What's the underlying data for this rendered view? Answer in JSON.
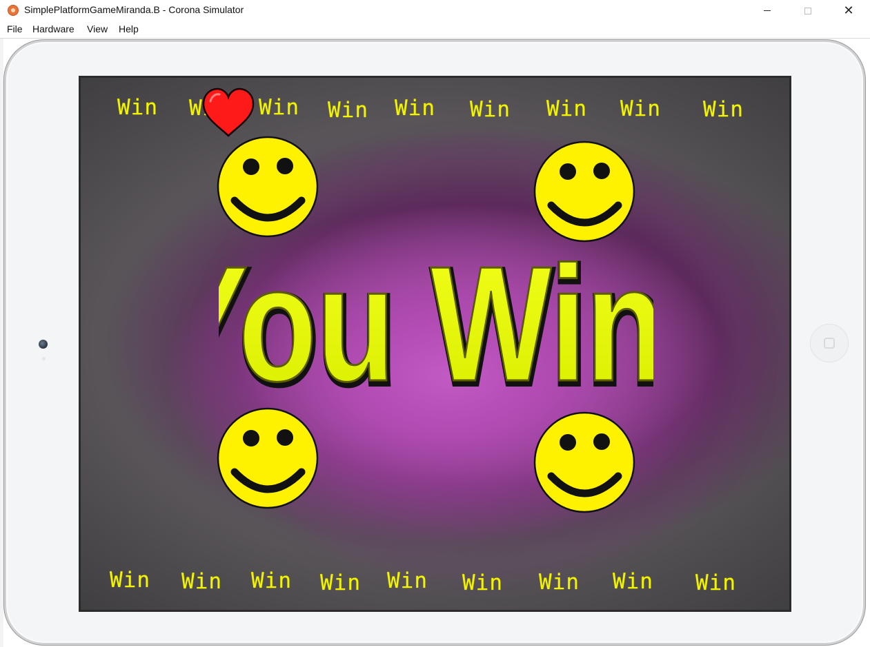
{
  "window": {
    "title": "SimplePlatformGameMiranda.B - Corona Simulator",
    "app_icon": "corona-icon"
  },
  "menu": {
    "items": [
      "File",
      "Hardware",
      "View",
      "Help"
    ]
  },
  "game": {
    "headline": "You Win!",
    "win_word": "Win",
    "top_win_count": 9,
    "bottom_win_count": 9,
    "smiley_count": 4,
    "colors": {
      "text_yellow": "#f3f500",
      "smiley_yellow": "#fff200",
      "heart_red": "#ff1a1a",
      "background_purple": "#b04bb2"
    }
  },
  "device": {
    "home_button_icon": "home-button-icon",
    "camera_icon": "camera-icon"
  }
}
